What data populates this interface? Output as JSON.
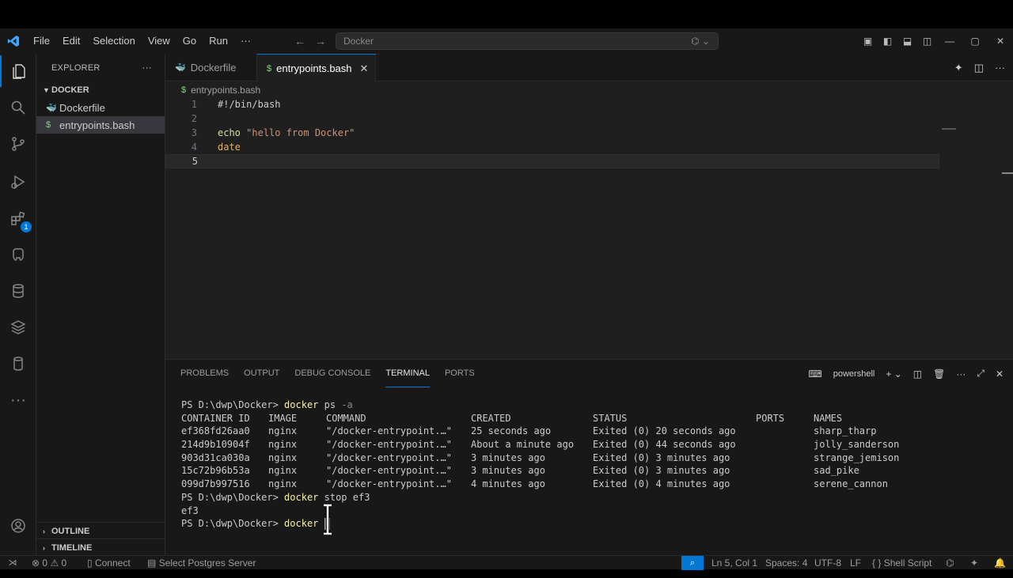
{
  "titlebar": {
    "menu": [
      "File",
      "Edit",
      "Selection",
      "View",
      "Go",
      "Run",
      "···"
    ],
    "search_text": "Docker"
  },
  "sidebar": {
    "header": "EXPLORER",
    "folder": "DOCKER",
    "files": [
      {
        "name": "Dockerfile",
        "icon": "docker-icon"
      },
      {
        "name": "entrypoints.bash",
        "icon": "dollar-icon"
      }
    ],
    "outline": "OUTLINE",
    "timeline": "TIMELINE"
  },
  "activity": {
    "extensions_badge": "1"
  },
  "tabs": [
    {
      "label": "Dockerfile",
      "icon": "docker-icon"
    },
    {
      "label": "entrypoints.bash",
      "icon": "dollar-icon"
    }
  ],
  "breadcrumb": "entrypoints.bash",
  "editor": {
    "lines": [
      {
        "n": "1",
        "text": "#!/bin/bash"
      },
      {
        "n": "2",
        "text": ""
      },
      {
        "n": "3",
        "cmd": "echo",
        "str": "\"hello from Docker\""
      },
      {
        "n": "4",
        "date": "date"
      },
      {
        "n": "5",
        "text": ""
      }
    ]
  },
  "panel": {
    "tabs": [
      "PROBLEMS",
      "OUTPUT",
      "DEBUG CONSOLE",
      "TERMINAL",
      "PORTS"
    ],
    "active_tab": "TERMINAL",
    "shell": "powershell"
  },
  "terminal": {
    "prompt": "PS D:\\dwp\\Docker> ",
    "cmd1": {
      "cmd": "docker",
      "args": " ps",
      "flag": " -a"
    },
    "headers": [
      "CONTAINER ID",
      "IMAGE",
      "COMMAND",
      "CREATED",
      "STATUS",
      "PORTS",
      "NAMES"
    ],
    "rows": [
      [
        "ef368fd26aa0",
        "nginx",
        "\"/docker-entrypoint.…\"",
        "25 seconds ago",
        "Exited (0) 20 seconds ago",
        "",
        "sharp_tharp"
      ],
      [
        "214d9b10904f",
        "nginx",
        "\"/docker-entrypoint.…\"",
        "About a minute ago",
        "Exited (0) 44 seconds ago",
        "",
        "jolly_sanderson"
      ],
      [
        "903d31ca030a",
        "nginx",
        "\"/docker-entrypoint.…\"",
        "3 minutes ago",
        "Exited (0) 3 minutes ago",
        "",
        "strange_jemison"
      ],
      [
        "15c72b96b53a",
        "nginx",
        "\"/docker-entrypoint.…\"",
        "3 minutes ago",
        "Exited (0) 3 minutes ago",
        "",
        "sad_pike"
      ],
      [
        "099d7b997516",
        "nginx",
        "\"/docker-entrypoint.…\"",
        "4 minutes ago",
        "Exited (0) 4 minutes ago",
        "",
        "serene_cannon"
      ]
    ],
    "cmd2": {
      "cmd": "docker",
      "args": " stop ef3"
    },
    "output2": "ef3",
    "cmd3": {
      "cmd": "docker",
      "args": " "
    }
  },
  "statusbar": {
    "errors": "0",
    "warnings": "0",
    "connect": "Connect",
    "postgres": "Select Postgres Server",
    "position": "Ln 5, Col 1",
    "spaces": "Spaces: 4",
    "encoding": "UTF-8",
    "eol": "LF",
    "language": "Shell Script"
  },
  "colors": {
    "accent": "#0078d4",
    "bg": "#1f1f1f",
    "chrome": "#181818"
  }
}
